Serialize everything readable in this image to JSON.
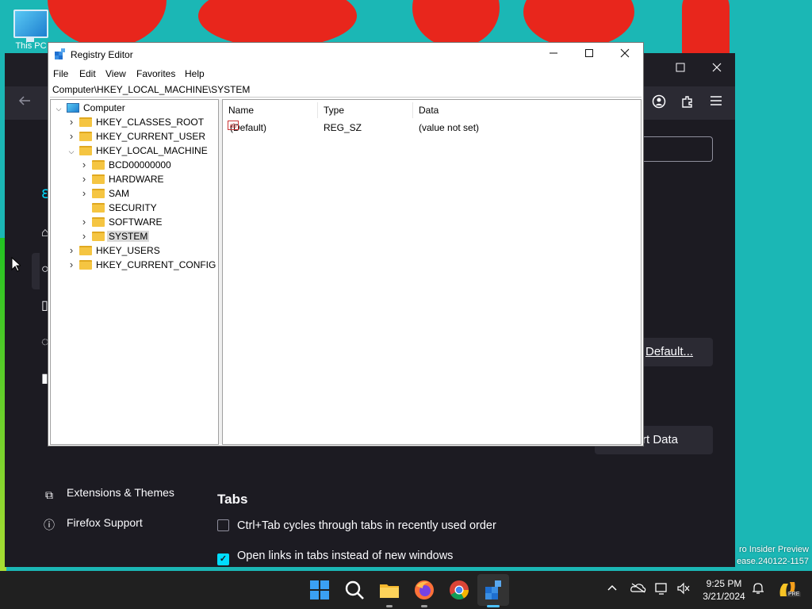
{
  "desktop": {
    "icon_label": "This PC",
    "watermark": [
      "ro Insider Preview",
      "ease.240122-1157"
    ]
  },
  "firefox": {
    "default_button": "Default...",
    "export_button": "rt Data",
    "sidebar_links": [
      {
        "label": "Extensions & Themes",
        "icon": "puzzle-icon"
      },
      {
        "label": "Firefox Support",
        "icon": "help-icon"
      }
    ],
    "tabs_heading": "Tabs",
    "checkboxes": [
      {
        "label": "Ctrl+Tab cycles through tabs in recently used order",
        "checked": false
      },
      {
        "label": "Open links in tabs instead of new windows",
        "checked": true
      }
    ]
  },
  "regedit": {
    "title": "Registry Editor",
    "menu": [
      "File",
      "Edit",
      "View",
      "Favorites",
      "Help"
    ],
    "address": "Computer\\HKEY_LOCAL_MACHINE\\SYSTEM",
    "tree": [
      {
        "label": "Computer",
        "level": 0,
        "expander": "expanded",
        "icon": "computer-icon"
      },
      {
        "label": "HKEY_CLASSES_ROOT",
        "level": 1,
        "expander": "collapsed",
        "icon": "folder-icon"
      },
      {
        "label": "HKEY_CURRENT_USER",
        "level": 1,
        "expander": "collapsed",
        "icon": "folder-icon"
      },
      {
        "label": "HKEY_LOCAL_MACHINE",
        "level": 1,
        "expander": "expanded",
        "icon": "folder-icon"
      },
      {
        "label": "BCD00000000",
        "level": 2,
        "expander": "collapsed",
        "icon": "folder-icon"
      },
      {
        "label": "HARDWARE",
        "level": 2,
        "expander": "collapsed",
        "icon": "folder-icon"
      },
      {
        "label": "SAM",
        "level": 2,
        "expander": "collapsed",
        "icon": "folder-icon"
      },
      {
        "label": "SECURITY",
        "level": 2,
        "expander": "none",
        "icon": "folder-icon"
      },
      {
        "label": "SOFTWARE",
        "level": 2,
        "expander": "collapsed",
        "icon": "folder-icon"
      },
      {
        "label": "SYSTEM",
        "level": 2,
        "expander": "collapsed",
        "icon": "folder-icon",
        "selected": true
      },
      {
        "label": "HKEY_USERS",
        "level": 1,
        "expander": "collapsed",
        "icon": "folder-icon"
      },
      {
        "label": "HKEY_CURRENT_CONFIG",
        "level": 1,
        "expander": "collapsed",
        "icon": "folder-icon"
      }
    ],
    "columns": [
      "Name",
      "Type",
      "Data"
    ],
    "values": [
      {
        "name": "(Default)",
        "type": "REG_SZ",
        "data": "(value not set)",
        "icon": "string-value-icon",
        "icon_text": "ab"
      }
    ]
  },
  "taskbar": {
    "apps": [
      "start-icon",
      "search-icon",
      "file-explorer-icon",
      "firefox-icon",
      "chrome-icon",
      "registry-editor-icon"
    ],
    "time": "9:25 PM",
    "date": "3/21/2024",
    "copilot_badge": "PRE"
  },
  "colors": {
    "wallpaper": "#1bb7b5",
    "wallpaper_accent": "#e8261c",
    "firefox_bg": "#1c1b22",
    "firefox_accent": "#00ddff",
    "taskbar": "#202020",
    "selection": "#d9d9d9"
  }
}
